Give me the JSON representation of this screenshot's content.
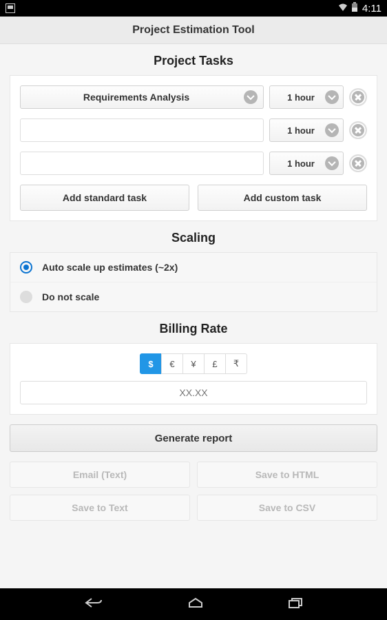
{
  "status": {
    "time": "4:11"
  },
  "header": {
    "title": "Project Estimation Tool"
  },
  "tasks": {
    "title": "Project Tasks",
    "rows": [
      {
        "task": "Requirements Analysis",
        "duration": "1 hour"
      },
      {
        "task": "",
        "duration": "1 hour"
      },
      {
        "task": "",
        "duration": "1 hour"
      }
    ],
    "add_standard": "Add standard task",
    "add_custom": "Add custom task"
  },
  "scaling": {
    "title": "Scaling",
    "options": [
      {
        "label": "Auto scale up estimates (~2x)",
        "checked": true
      },
      {
        "label": "Do not scale",
        "checked": false
      }
    ]
  },
  "billing": {
    "title": "Billing Rate",
    "currencies": [
      "$",
      "€",
      "¥",
      "£",
      "₹"
    ],
    "active_currency": "$",
    "placeholder": "XX.XX"
  },
  "actions": {
    "generate": "Generate report",
    "exports": [
      "Email (Text)",
      "Save to HTML",
      "Save to Text",
      "Save to CSV"
    ]
  }
}
